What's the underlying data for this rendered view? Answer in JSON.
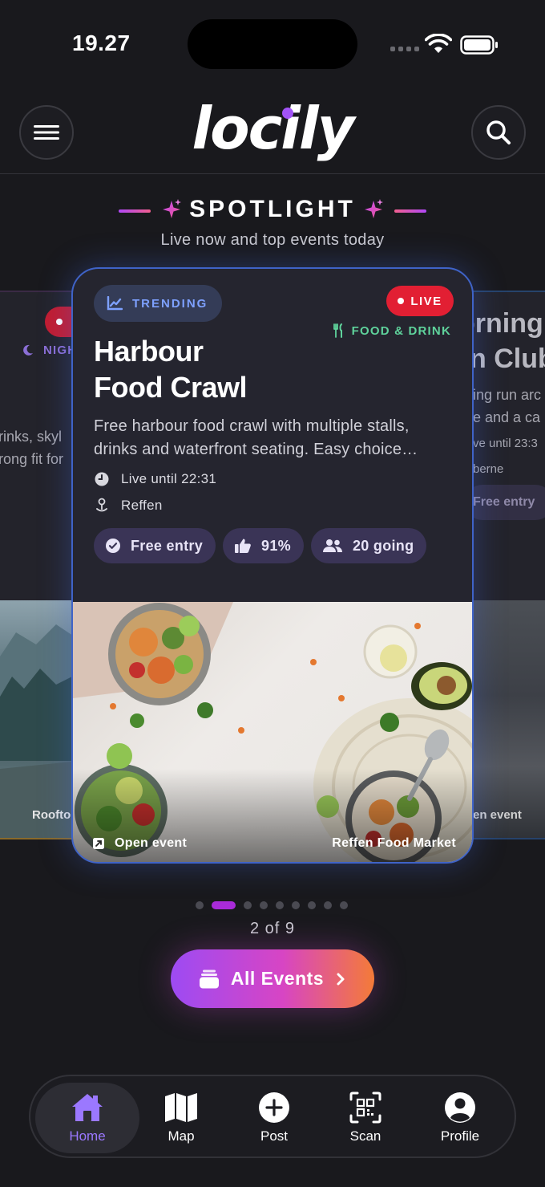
{
  "status_bar": {
    "time": "19.27"
  },
  "header": {
    "logo": "locily"
  },
  "spotlight": {
    "title": "SPOTLIGHT",
    "subtitle": "Live now and top events today"
  },
  "side_left": {
    "category": "NIGH",
    "desc_line1": "rinks, skyl",
    "desc_line2": "rong fit for",
    "img_label": "Rooftop"
  },
  "side_right": {
    "title_line1": "orning",
    "title_line2": "n Club",
    "desc_line1": "ing run arc",
    "desc_line2": "e and a ca",
    "time": "ve until 23:3",
    "place": "berne",
    "chip": "Free entry",
    "img_label": "en event"
  },
  "card": {
    "badge": "TRENDING",
    "live": "LIVE",
    "category": "FOOD & DRINK",
    "title_line1": "Harbour",
    "title_line2": "Food Crawl",
    "description": "Free harbour food crawl with multiple stalls, drinks and waterfront seating. Easy choice…",
    "time": "Live until 22:31",
    "place": "Reffen",
    "chips": [
      "Free entry",
      "91%",
      "20 going"
    ],
    "open_label": "Open event",
    "venue": "Reffen Food Market"
  },
  "pager": {
    "current": 2,
    "total": 9,
    "text": "2 of 9"
  },
  "cta": {
    "label": "All Events"
  },
  "tabs": [
    {
      "label": "Home",
      "icon": "home-icon",
      "active": true
    },
    {
      "label": "Map",
      "icon": "map-icon",
      "active": false
    },
    {
      "label": "Post",
      "icon": "plus-circle-icon",
      "active": false
    },
    {
      "label": "Scan",
      "icon": "qr-scan-icon",
      "active": false
    },
    {
      "label": "Profile",
      "icon": "profile-icon",
      "active": false
    }
  ],
  "colors": {
    "background": "#19191d",
    "accent_purple": "#a253f7",
    "live_red": "#e21f33",
    "category_green": "#5fd39c",
    "trending_blue": "#7ea1ff",
    "card_border": "#3f63c7"
  }
}
